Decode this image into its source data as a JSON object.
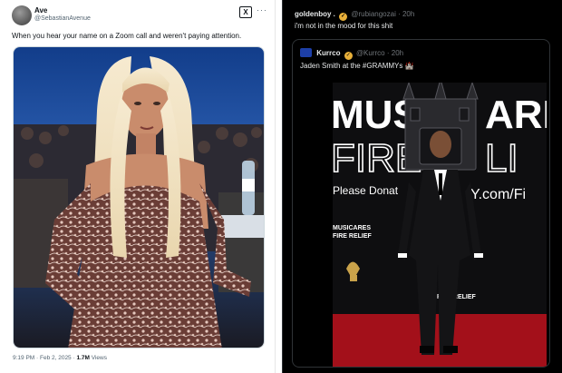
{
  "left_tweet": {
    "display_name": "Ave",
    "handle": "@SebastianAvenue",
    "logo_text": "X",
    "more_label": "···",
    "text": "When you hear your name on a Zoom call and weren't paying attention.",
    "timestamp": "9:19 PM · Feb 2, 2025 ·",
    "views_count": "1.7M",
    "views_label": "Views",
    "media_icon": "photo-of-woman-at-grammys"
  },
  "right_tweet": {
    "display_name": "goldenboy .",
    "handle": "@rubiangozai",
    "time": "20h",
    "text": "i'm not in the mood for this shit",
    "quoted": {
      "display_name": "Kurrco",
      "handle": "@Kurrco",
      "time": "20h",
      "text": "Jaden Smith at the #GRAMMYs 🏰",
      "backdrop_word_1": "MUSI",
      "backdrop_word_1b": "ARE",
      "backdrop_word_2": "FIRE",
      "backdrop_word_2b": "LI",
      "backdrop_word_3": "Please Donat",
      "backdrop_word_3b": "Y.com/Fi",
      "backdrop_logo_1": "MUSICARES",
      "backdrop_logo_2": "FIRE RELIEF"
    }
  },
  "colors": {
    "light_bg": "#ffffff",
    "dark_bg": "#000000",
    "verified_gold": "#e8b03a",
    "carpet_red": "#a3101a"
  }
}
